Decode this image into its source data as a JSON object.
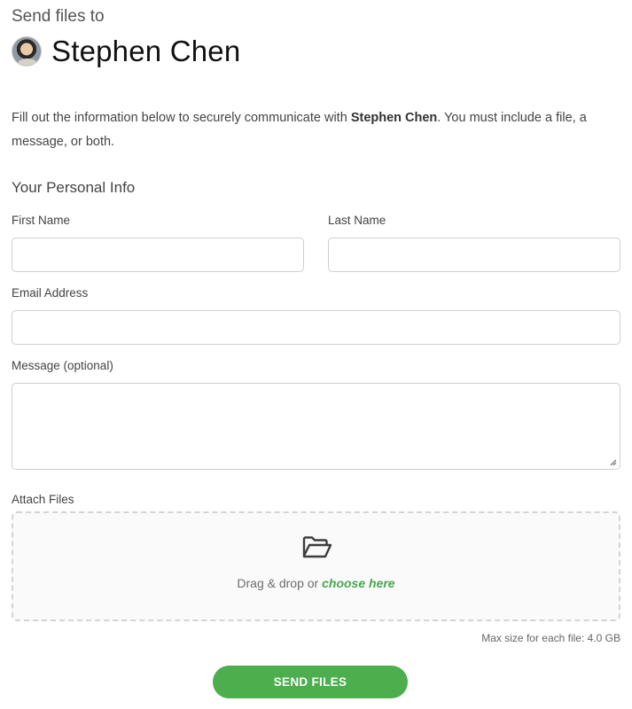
{
  "header": {
    "send_to_label": "Send files to",
    "recipient_name": "Stephen Chen"
  },
  "intro": {
    "before": "Fill out the information below to securely communicate with ",
    "name": "Stephen Chen",
    "after": ". You must include a file, a message, or both."
  },
  "form": {
    "section_title": "Your Personal Info",
    "first_name_label": "First Name",
    "first_name_value": "",
    "last_name_label": "Last Name",
    "last_name_value": "",
    "email_label": "Email Address",
    "email_value": "",
    "message_label": "Message (optional)",
    "message_value": "",
    "attach_label": "Attach Files",
    "drop_text": "Drag & drop or ",
    "choose_link": "choose here",
    "max_size_text": "Max size for each file: 4.0 GB",
    "submit_label": "SEND FILES"
  },
  "icons": {
    "avatar": "user-avatar",
    "drop": "folder-open-icon"
  },
  "colors": {
    "accent": "#4cae4c",
    "link": "#47a84b"
  }
}
